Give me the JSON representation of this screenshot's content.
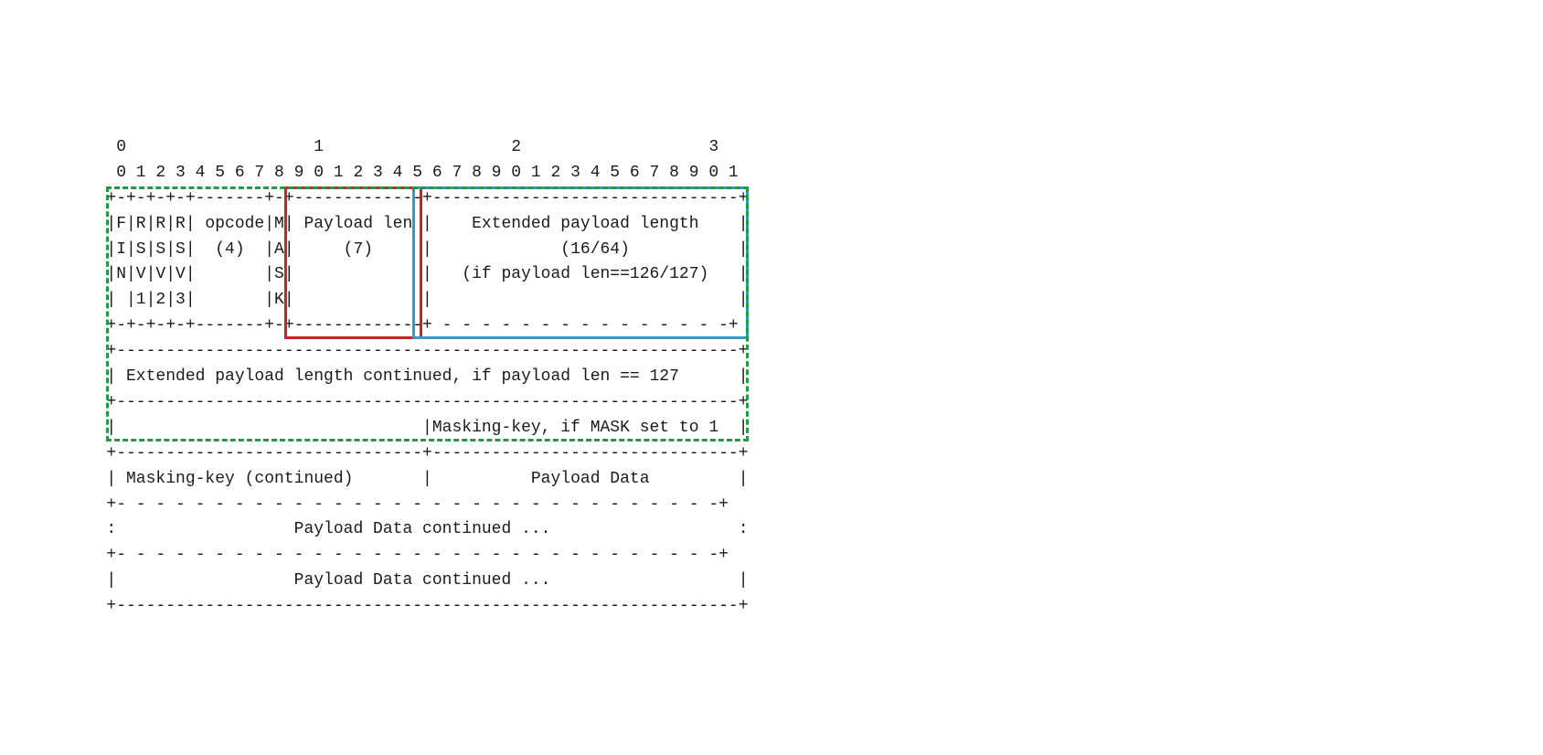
{
  "diagram": {
    "ruler_top": "0                   1                   2                   3",
    "ruler_bits": "0 1 2 3 4 5 6 7 8 9 0 1 2 3 4 5 6 7 8 9 0 1 2 3 4 5 6 7 8 9 0 1",
    "lines": [
      "+-+-+-+-+-------+-+-------------+-------------------------------+",
      "|F|R|R|R| opcode|M| Payload len |    Extended payload length    |",
      "|I|S|S|S|  (4)  |A|     (7)     |             (16/64)           |",
      "|N|V|V|V|       |S|             |   (if payload len==126/127)   |",
      "| |1|2|3|       |K|             |                               |",
      "+-+-+-+-+-------+-+-------------+ - - - - - - - - - - - - - - -+",
      "+---------------------------------------------------------------+",
      "| Extended payload length continued, if payload len == 127      |",
      "+-------+-------------------------------------------------------+",
      "|       |Masking-key, if MASK set to 1                          |",
      "+-------+-------+-+---------------------------------------------+",
      "| Masking-key (continued)       |          Payload Data         |",
      "+-------------------------------- - - - - - - - - - - - - - - - +",
      ":                     Payload Data continued ...                :",
      "+ - - - - - - - - - - - - - - - - - - - - - - - - - - - - - - +",
      "|                  Payload Data continued ...                   |",
      "+---------------------------------------------------------------+"
    ]
  }
}
